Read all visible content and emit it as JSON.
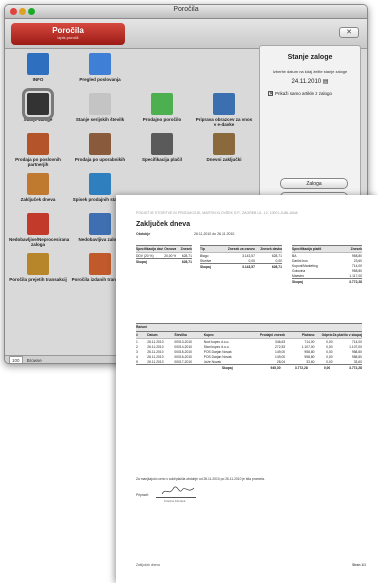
{
  "window": {
    "title": "Poročila"
  },
  "header": {
    "button_title": "Poročila",
    "button_sub": "izpis poročil",
    "close": "✕"
  },
  "tiles": [
    {
      "label": "INFO",
      "color": "#2f6fbf",
      "sel": false
    },
    {
      "label": "Pregled poslovanja",
      "color": "#3f7fd6",
      "sel": false
    },
    {
      "label": "Stanje zaloge",
      "color": "#333333",
      "sel": true
    },
    {
      "label": "Stanje serijskih številk",
      "color": "#c4c4c4",
      "sel": false
    },
    {
      "label": "Prodajno poročilo",
      "color": "#4caf50",
      "sel": false
    },
    {
      "label": "Priprava obrazcev za vnos v e-davke",
      "color": "#3c6fb0",
      "sel": false
    },
    {
      "label": "Prodaja po poslovnih partnerjih",
      "color": "#b3542a",
      "sel": false
    },
    {
      "label": "Prodaja po uporabnikih",
      "color": "#8a5a3c",
      "sel": false
    },
    {
      "label": "Specifikacija plačil",
      "color": "#5a5a5a",
      "sel": false
    },
    {
      "label": "Dnevni zaključki",
      "color": "#8a6a3c",
      "sel": false
    },
    {
      "label": "Zaključek dneva",
      "color": "#c07a30",
      "sel": false
    },
    {
      "label": "Spisek prodajnih statistik",
      "color": "#2f7fbf",
      "sel": false
    },
    {
      "label": "Nedobavljive/Neprocesirana zaloga",
      "color": "#c23a2a",
      "sel": false
    },
    {
      "label": "Nedobavljiva zaloga",
      "color": "#3f6fb0",
      "sel": false
    },
    {
      "label": "Poročila prejetih transakcij",
      "color": "#b8862a",
      "sel": false
    },
    {
      "label": "Poročila izdanih transakcij",
      "color": "#c05a2a",
      "sel": false
    }
  ],
  "panel": {
    "title": "Stanje zaloge",
    "info": "Izberite datum na kdaj želite stanje zaloge",
    "date": "24.11.2010",
    "checkbox": "Prikaži samo artikle z zalogo",
    "btn1": "Zaloga",
    "btn2": "Zaloga brez cen"
  },
  "status": {
    "zoom": "100",
    "browse": "Browse"
  },
  "report": {
    "company": "PODJETJE STORITVE IN PRODUKCIJE, MARTIN KLOVŠEK S.P., ZAGREB UL. 12, 1000 LJUBLJANA",
    "title": "Zaključek dneva",
    "period_label": "Obdobje",
    "period": "26.11.2010 do 26.11.2010",
    "t1": {
      "h": [
        "Specifikacija davkov",
        "Osnova",
        "Znesek"
      ],
      "rows": [
        [
          "DDV (20 %)",
          "20,00 %",
          "628,71"
        ]
      ],
      "total": [
        "Skupaj",
        "",
        "628,71"
      ]
    },
    "t2": {
      "h": [
        "Tip",
        "Znesek za osnovo",
        "Znesek davka"
      ],
      "rows": [
        [
          "Blago",
          "3.143,57",
          "628,71"
        ],
        [
          "Storitve",
          "0,00",
          "0,00"
        ]
      ],
      "total": [
        "Skupaj",
        "3.143,57",
        "628,71"
      ]
    },
    "t3": {
      "h": [
        "Specifikacija plačil",
        "Znesek"
      ],
      "rows": [
        [
          "BA",
          "958,80"
        ],
        [
          "Darilni bon",
          "23,60"
        ],
        [
          "Kuponi/Marketing",
          "714,00"
        ],
        [
          "Gotovina",
          "958,80"
        ],
        [
          "Maestro",
          "1.117,00"
        ]
      ],
      "total": [
        "Skupaj",
        "3.772,28"
      ]
    },
    "t4": {
      "title": "Računi",
      "h": [
        "#",
        "Datum",
        "Številka",
        "Kupec",
        "Prodajni znesek",
        "Plačano",
        "Odprto",
        "Za plačilo v skupaj"
      ],
      "rows": [
        [
          "1",
          "26.11.2010",
          "00013-2010",
          "Novi kupec d.o.o.",
          "346,63",
          "714,00",
          "0,00",
          "714,00"
        ],
        [
          "2",
          "26.11.2010",
          "00014-2010",
          "Stari kupec d.o.o.",
          "272,53",
          "1.107,00",
          "0,00",
          "1.107,00"
        ],
        [
          "3",
          "26.11.2010",
          "00015-2010",
          "POS Darjan Novak",
          "149,00",
          "958,80",
          "0,00",
          "958,80"
        ],
        [
          "4",
          "26.11.2010",
          "00016-2010",
          "POS Darjan Novak",
          "149,00",
          "958,80",
          "0,00",
          "958,80"
        ],
        [
          "5",
          "26.11.2010",
          "00017-2010",
          "Jože Novak",
          "28,04",
          "33,60",
          "0,00",
          "33,60"
        ]
      ],
      "total": [
        "Skupaj",
        "945,30",
        "3.772,28",
        "0,00",
        "3.772,28"
      ]
    },
    "note": "Za manjkajočo ceno v sobi/plačila obdobje od 26.11.2010 po 26.11.2010 je bila prometa.",
    "sig_label": "Pripravil:",
    "sig_name": "Kristina Klovšek",
    "footer": "Zaključek dneva",
    "page": "Stran 1/1"
  }
}
